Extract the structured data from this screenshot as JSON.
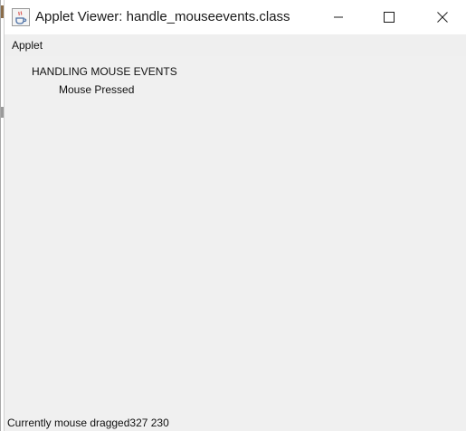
{
  "window": {
    "title": "Applet Viewer: handle_mouseevents.class",
    "icon": "java-coffee-cup-icon",
    "controls": [
      "minimize-icon",
      "maximize-icon",
      "close-icon"
    ]
  },
  "menubar": {
    "items": [
      {
        "label": "Applet"
      }
    ]
  },
  "applet": {
    "heading": "HANDLING MOUSE EVENTS",
    "event_message": "Mouse Pressed",
    "status": "Currently mouse dragged327 230"
  },
  "colors": {
    "content_background": "#f0f0f0",
    "menubar_background": "#efefef",
    "titlebar_background": "#ffffff",
    "text": "#111111"
  }
}
